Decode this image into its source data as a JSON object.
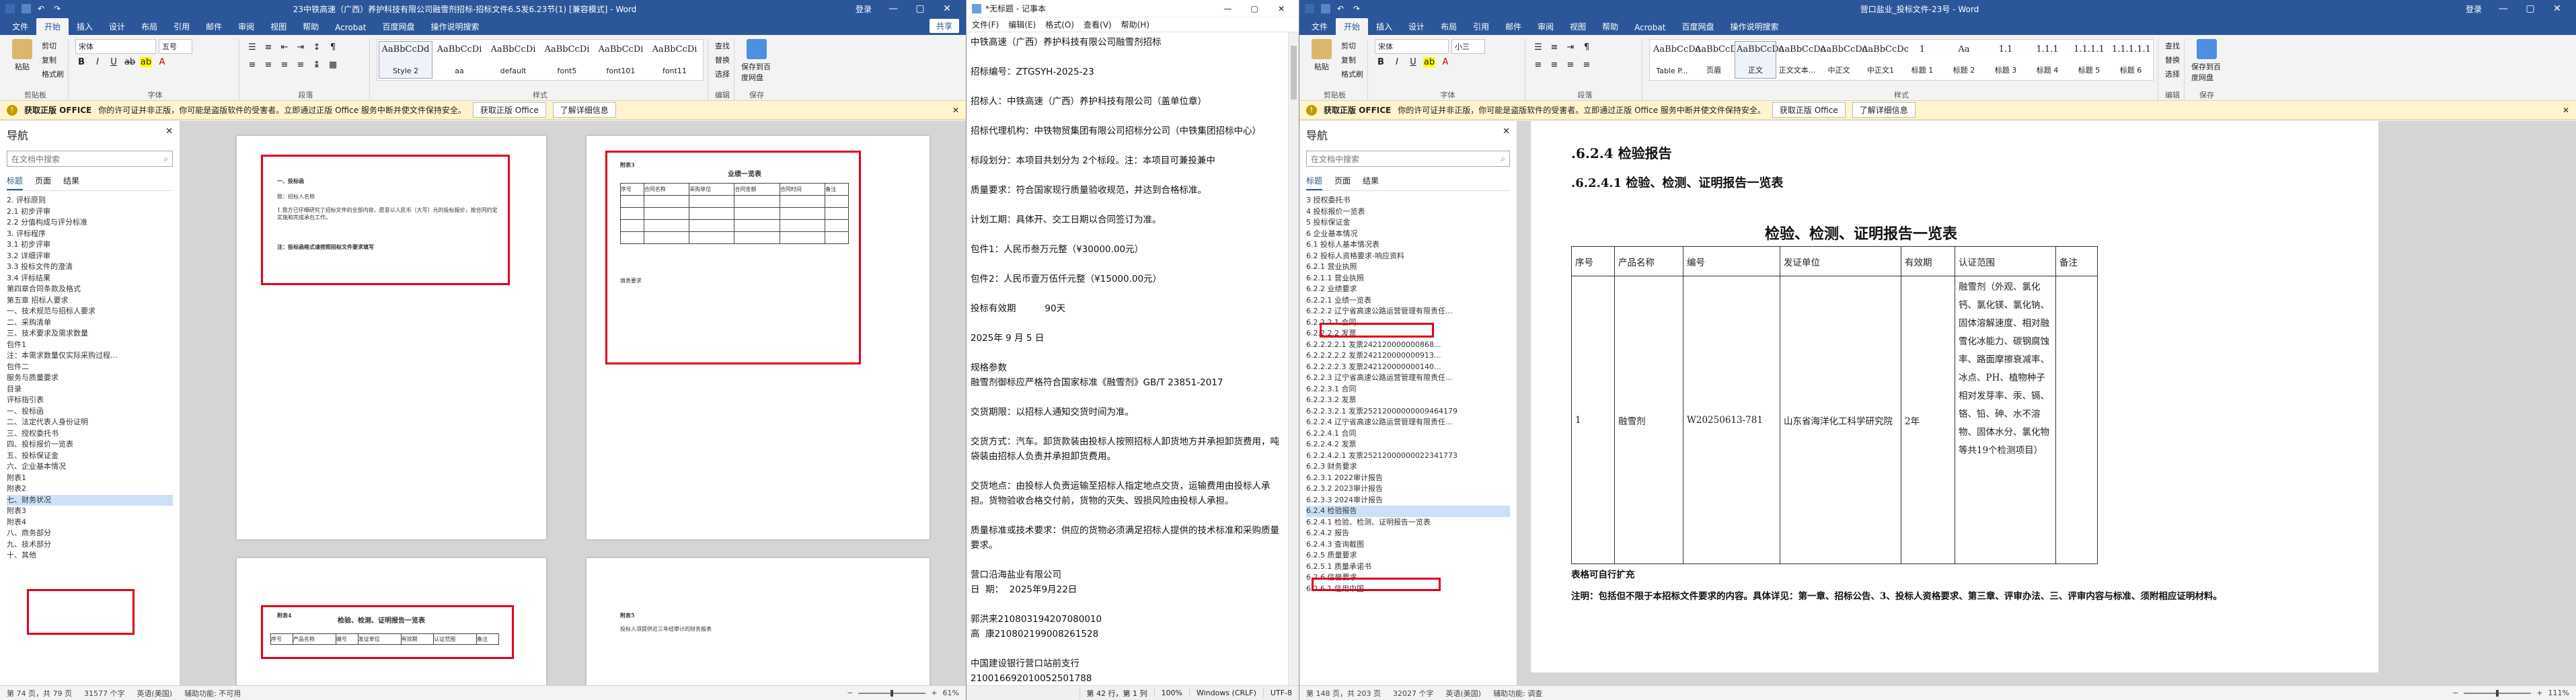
{
  "wordLeft": {
    "title": "23中铁高速（广西）养护科技有限公司融雪剂招标-招标文件6.5发6.23节(1) [兼容模式] - Word",
    "signin": "登录",
    "menu_tabs": [
      "文件",
      "开始",
      "插入",
      "设计",
      "布局",
      "引用",
      "邮件",
      "审阅",
      "视图",
      "帮助",
      "Acrobat",
      "百度网盘",
      "操作说明搜索"
    ],
    "share": "共享",
    "font_name": "宋体",
    "font_size": "五号",
    "ribbon_groups": {
      "clipboard": "剪贴板",
      "font": "字体",
      "paragraph": "段落",
      "styles": "样式",
      "editing": "编辑",
      "save": "保存"
    },
    "styles": [
      {
        "sample": "AaBbCcDd",
        "name": "Style 2"
      },
      {
        "sample": "AaBbCcDi",
        "name": "aa"
      },
      {
        "sample": "AaBbCcDi",
        "name": "default"
      },
      {
        "sample": "AaBbCcDi",
        "name": "font5"
      },
      {
        "sample": "AaBbCcDi",
        "name": "font101"
      },
      {
        "sample": "AaBbCcDi",
        "name": "font11"
      }
    ],
    "edit_items": [
      "查找",
      "替换",
      "选择"
    ],
    "save_label": "保存到百度网盘",
    "paste_label": "粘贴",
    "clipboard_items": [
      "剪切",
      "复制",
      "格式刷"
    ],
    "protect": {
      "badge": "获取正版 OFFICE",
      "text": "你的许可证并非正版，你可能是盗版软件的受害者。立即通过正版 Office 服务中断并使文件保持安全。",
      "btn1": "获取正版 Office",
      "btn2": "了解详细信息"
    },
    "nav": {
      "title": "导航",
      "search_placeholder": "在文档中搜索",
      "tabs": [
        "标题",
        "页面",
        "结果"
      ],
      "items": [
        "2. 评标原则",
        "2.1 初步评审",
        "2.2 分值构成与评分标准",
        "3. 评标程序",
        "3.1 初步评审",
        "3.2 详细评审",
        "3.3 投标文件的澄清",
        "3.4 评标结果",
        "第四章合同条款及格式",
        "第五章 招标人要求",
        "一、技术规范与招标人要求",
        "二、采购清单",
        "三、技术要求及需求数量",
        "包件1",
        "注：本需求数量仅实际采购过程...",
        "包件二",
        "服务与质量要求",
        "目录",
        "评标指引表",
        "一、投标函",
        "二、法定代表人身份证明",
        "三、授权委托书",
        "四、投标报价一览表",
        "五、投标保证金",
        "六、企业基本情况",
        "附表1",
        "附表2",
        "七、财务状况",
        "附表3",
        "附表4",
        "八、商务部分",
        "九、技术部分",
        "十、其他"
      ],
      "selected_index": 27
    },
    "status": {
      "page": "第 74 页，共 79 页",
      "words": "31577 个字",
      "lang": "英语(美国)",
      "mode": "辅助功能: 不可用",
      "zoom": "61%"
    },
    "pages": {
      "p1": {
        "title": "一、投标函",
        "to": "致：招标人名称",
        "body": "1.我方已仔细研究了招标文件的全部内容，愿意以人民币（大写）元的投标报价，按合同约定实施和完成承包工作。",
        "note": "注：投标函格式请按照招标文件要求填写"
      },
      "p2": {
        "title": "附表3",
        "table_title": "业绩一览表",
        "heads": [
          "序号",
          "合同名称",
          "采购单位",
          "合同金额",
          "合同时间",
          "备注"
        ],
        "note": "填表要求"
      },
      "p3": {
        "title": "附表4",
        "table_title": "检验、检测、证明报告一览表",
        "heads": [
          "序号",
          "产品名称",
          "编号",
          "发证单位",
          "有效期",
          "认证范围",
          "备注"
        ]
      },
      "p4": {
        "title": "附表5",
        "text": "投标人须提供近三年经审计的财务报表"
      }
    }
  },
  "notepad": {
    "title": "*无标题 - 记事本",
    "menu": [
      "文件(F)",
      "编辑(E)",
      "格式(O)",
      "查看(V)",
      "帮助(H)"
    ],
    "lines": [
      "中铁高速（广西）养护科技有限公司融雪剂招标",
      "",
      "招标编号：ZTGSYH-2025-23",
      "",
      "招标人：中铁高速（广西）养护科技有限公司（盖单位章）",
      "",
      "招标代理机构：中铁物贸集团有限公司招标分公司（中铁集团招标中心）",
      "",
      "标段划分：本项目共划分为 2个标段。注：本项目可兼投兼中",
      "",
      "质量要求：符合国家现行质量验收规范，并达到合格标准。",
      "",
      "计划工期：具体开、交工日期以合同签订为准。",
      "",
      "包件1：人民币叁万元整（¥30000.00元）",
      "",
      "包件2：人民币壹万伍仟元整（¥15000.00元）",
      "",
      "投标有效期          90天",
      "",
      "2025年 9 月 5 日",
      "",
      "规格参数",
      "融雪剂御标应严格符合国家标准《融雪剂》GB/T 23851-2017",
      "",
      "交货期限：以招标人通知交货时间为准。",
      "",
      "交货方式：汽车。卸货款装由投标人按照招标人卸货地方并承担卸货费用，吨袋装由招标人负责并承担卸货费用。",
      "",
      "交货地点：由投标人负责运输至招标人指定地点交货，运输费用由投标人承担。货物验收合格交付前，货物的灭失、毁损风险由投标人承担。",
      "",
      "质量标准或技术要求：供应的货物必须满足招标人提供的技术标准和采购质量要求。",
      "",
      "营口沿海盐业有限公司",
      "日  期：  2025年9月22日",
      "",
      "郭洪来210803194207080010",
      "高  康210802199008261528",
      "",
      "中国建设银行营口站前支行",
      "210016692010052501788"
    ],
    "status": {
      "pos": "第 42 行，第 1 列",
      "zoom": "100%",
      "eol": "Windows (CRLF)",
      "enc": "UTF-8"
    }
  },
  "wordRight": {
    "title": "营口盐业_投标文件-23号 - Word",
    "signin": "登录",
    "menu_tabs": [
      "文件",
      "开始",
      "插入",
      "设计",
      "布局",
      "引用",
      "邮件",
      "审阅",
      "视图",
      "帮助",
      "Acrobat",
      "百度网盘",
      "操作说明搜索"
    ],
    "font_name": "宋体",
    "font_size": "小三",
    "styles": [
      {
        "sample": "AaBbCcDc",
        "name": "Table P..."
      },
      {
        "sample": "AaBbCcDc",
        "name": "页眉"
      },
      {
        "sample": "AaBbCcDc",
        "name": "正文"
      },
      {
        "sample": "AaBbCcDc",
        "name": "正文文本..."
      },
      {
        "sample": "AaBbCcDc",
        "name": "中正文"
      },
      {
        "sample": "AaBbCcDc",
        "name": "中正文1"
      },
      {
        "sample": "1",
        "name": "标题 1"
      },
      {
        "sample": "Aa",
        "name": "标题 2"
      },
      {
        "sample": "1.1",
        "name": "标题 3"
      },
      {
        "sample": "1.1.1",
        "name": "标题 4"
      },
      {
        "sample": "1.1.1.1",
        "name": "标题 5"
      },
      {
        "sample": "1.1.1.1.1",
        "name": "标题 6"
      }
    ],
    "edit_items": [
      "查找",
      "替换",
      "选择"
    ],
    "save_label": "保存到百度网盘",
    "paste_label": "粘贴",
    "clipboard_items": [
      "剪切",
      "复制",
      "格式刷"
    ],
    "protect": {
      "badge": "获取正版 OFFICE",
      "text": "你的许可证并非正版，你可能是盗版软件的受害者。立即通过正版 Office 服务中断并使文件保持安全。",
      "btn1": "获取正版 Office",
      "btn2": "了解详细信息"
    },
    "nav": {
      "title": "导航",
      "search_placeholder": "在文档中搜索",
      "tabs": [
        "标题",
        "页面",
        "结果"
      ],
      "items": [
        "3 授权委托书",
        "4 投标报价一览表",
        "5 投标保证金",
        "6 企业基本情况",
        "6.1 投标人基本情况表",
        "6.2 投标人资格要求-响应资料",
        "6.2.1 营业执照",
        "6.2.1.1 营业执照",
        "6.2.2 业绩要求",
        "6.2.2.1 业绩一览表",
        "6.2.2.2 辽宁省高速公路运营管理有限责任...",
        "6.2.2.2.1 合同",
        "6.2.2.2.2 发票",
        "6.2.2.2.2.1 发票242120000000868...",
        "6.2.2.2.2.2 发票242120000000913...",
        "6.2.2.2.2.3 发票242120000000140...",
        "6.2.2.3 辽宁省高速公路运营管理有限责任...",
        "6.2.2.3.1 合同",
        "6.2.2.3.2 发票",
        "6.2.2.3.2.1 发票25212000000009464179",
        "6.2.2.4 辽宁省高速公路运营管理有限责任...",
        "6.2.2.4.1 合同",
        "6.2.2.4.2 发票",
        "6.2.2.4.2.1 发票25212000000022341773",
        "6.2.3 财务要求",
        "6.2.3.1 2022审计报告",
        "6.2.3.2 2023审计报告",
        "6.2.3.3 2024审计报告",
        "6.2.4 检验报告",
        "6.2.4.1 检验、检测、证明报告一览表",
        "6.2.4.2 报告",
        "6.2.4.3 查询截图",
        "6.2.5 质量要求",
        "6.2.5.1 质量承诺书",
        "6.2.6 信誉要求",
        "6.2.6.1 信用中国"
      ],
      "selected_index": 28
    },
    "doc": {
      "h1": ".6.2.4 检验报告",
      "h2": ".6.2.4.1   检验、检测、证明报告一览表",
      "table_title": "检验、检测、证明报告一览表",
      "heads": [
        "序号",
        "产品名称",
        "编号",
        "发证单位",
        "有效期",
        "认证范围",
        "备注"
      ],
      "row": {
        "no": "1",
        "name": "融雪剂",
        "code": "W20250613-781",
        "issuer": "山东省海洋化工科学研究院",
        "valid": "2年",
        "scope": "融雪剂（外观、氯化钙、氯化镁、氯化钠、固体溶解速度、相对融雪化冰能力、碳钢腐蚀率、路面摩擦衰减率、冰点、PH、植物种子相对发芽率、汞、镉、铬、铅、砷、水不溶物、固体水分、氯化物等共19个检测项目）",
        "remark": ""
      },
      "note1": "表格可自行扩充",
      "note2": "注明：包括但不限于本招标文件要求的内容。具体详见：第一章、招标公告、3、投标人资格要求、第三章、评审办法、三、评审内容与标准、须附相应证明材料。"
    },
    "status": {
      "page": "第 148 页，共 203 页",
      "words": "32027 个字",
      "lang": "英语(美国)",
      "mode": "辅助功能: 调查",
      "zoom": "111%"
    }
  },
  "colors": {
    "word_blue": "#2b579a",
    "highlight": "#e0001a",
    "nav_selected": "#cde0f7"
  }
}
